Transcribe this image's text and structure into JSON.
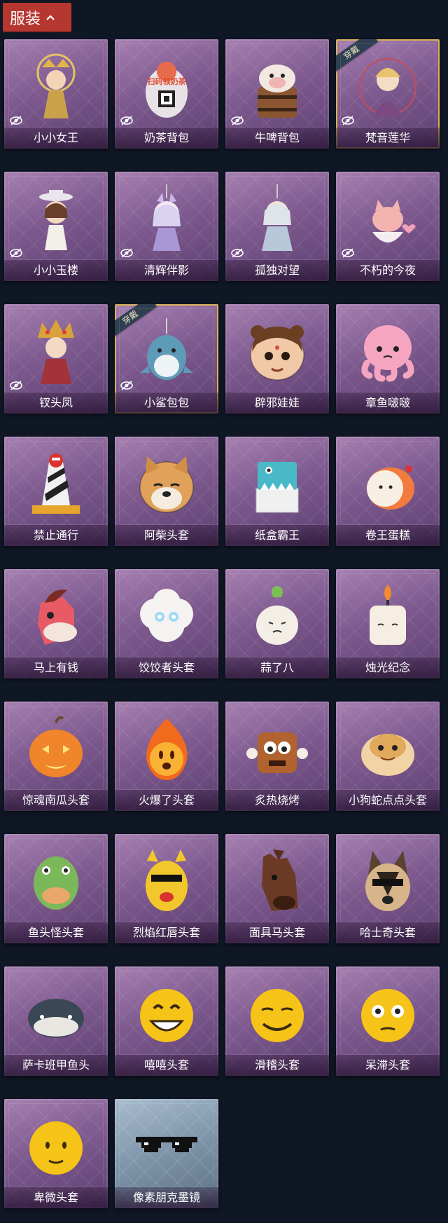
{
  "header": {
    "title": "服装"
  },
  "badge_text": "穿戴",
  "items": [
    {
      "name": "小小女王",
      "icon": "queen-figurine-icon",
      "hidden_eye": true,
      "equipped": false
    },
    {
      "name": "奶茶背包",
      "icon": "milk-tea-backpack-icon",
      "hidden_eye": true,
      "equipped": false,
      "art_text": "扫码领奶茶"
    },
    {
      "name": "牛啤背包",
      "icon": "cow-beer-backpack-icon",
      "hidden_eye": true,
      "equipped": false
    },
    {
      "name": "梵音莲华",
      "icon": "lotus-figurine-icon",
      "hidden_eye": true,
      "equipped": true
    },
    {
      "name": "小小玉楼",
      "icon": "jade-tower-figurine-icon",
      "hidden_eye": true,
      "equipped": false
    },
    {
      "name": "清辉伴影",
      "icon": "moonlight-figurine-icon",
      "hidden_eye": true,
      "equipped": false
    },
    {
      "name": "孤独对望",
      "icon": "lonely-gaze-figurine-icon",
      "hidden_eye": true,
      "equipped": false
    },
    {
      "name": "不朽的今夜",
      "icon": "fox-teacup-icon",
      "hidden_eye": true,
      "equipped": false
    },
    {
      "name": "钗头凤",
      "icon": "phoenix-crown-figurine-icon",
      "hidden_eye": true,
      "equipped": false
    },
    {
      "name": "小鲨包包",
      "icon": "shark-bag-icon",
      "hidden_eye": true,
      "equipped": true
    },
    {
      "name": "辟邪娃娃",
      "icon": "doll-head-icon",
      "hidden_eye": false,
      "equipped": false
    },
    {
      "name": "章鱼啵啵",
      "icon": "octopus-head-icon",
      "hidden_eye": false,
      "equipped": false
    },
    {
      "name": "禁止通行",
      "icon": "traffic-cone-icon",
      "hidden_eye": false,
      "equipped": false
    },
    {
      "name": "阿柴头套",
      "icon": "shiba-head-icon",
      "hidden_eye": false,
      "equipped": false
    },
    {
      "name": "纸盒霸王",
      "icon": "box-dino-icon",
      "hidden_eye": false,
      "equipped": false
    },
    {
      "name": "卷王蛋糕",
      "icon": "roll-cake-icon",
      "hidden_eye": false,
      "equipped": false
    },
    {
      "name": "马上有钱",
      "icon": "pink-horse-icon",
      "hidden_eye": false,
      "equipped": false
    },
    {
      "name": "饺饺者头套",
      "icon": "cloud-dumpling-icon",
      "hidden_eye": false,
      "equipped": false
    },
    {
      "name": "蒜了八",
      "icon": "garlic-icon",
      "hidden_eye": false,
      "equipped": false
    },
    {
      "name": "烛光纪念",
      "icon": "candle-icon",
      "hidden_eye": false,
      "equipped": false
    },
    {
      "name": "惊魂南瓜头套",
      "icon": "pumpkin-icon",
      "hidden_eye": false,
      "equipped": false
    },
    {
      "name": "火爆了头套",
      "icon": "fire-spirit-icon",
      "hidden_eye": false,
      "equipped": false
    },
    {
      "name": "炙热烧烤",
      "icon": "bbq-meat-icon",
      "hidden_eye": false,
      "equipped": false
    },
    {
      "name": "小狗蛇点点头套",
      "icon": "dog-snake-icon",
      "hidden_eye": false,
      "equipped": false
    },
    {
      "name": "鱼头怪头套",
      "icon": "fish-monster-icon",
      "hidden_eye": false,
      "equipped": false
    },
    {
      "name": "烈焰红唇头套",
      "icon": "yellow-lips-icon",
      "hidden_eye": false,
      "equipped": false
    },
    {
      "name": "面具马头套",
      "icon": "horse-mask-icon",
      "hidden_eye": false,
      "equipped": false
    },
    {
      "name": "哈士奇头套",
      "icon": "husky-icon",
      "hidden_eye": false,
      "equipped": false
    },
    {
      "name": "萨卡班甲鱼头",
      "icon": "whale-fish-icon",
      "hidden_eye": false,
      "equipped": false
    },
    {
      "name": "嘻嘻头套",
      "icon": "grin-emoji-icon",
      "hidden_eye": false,
      "equipped": false
    },
    {
      "name": "滑稽头套",
      "icon": "funny-emoji-icon",
      "hidden_eye": false,
      "equipped": false
    },
    {
      "name": "呆滞头套",
      "icon": "dazed-emoji-icon",
      "hidden_eye": false,
      "equipped": false
    },
    {
      "name": "卑微头套",
      "icon": "humble-emoji-icon",
      "hidden_eye": false,
      "equipped": false
    },
    {
      "name": "像素朋克墨镜",
      "icon": "pixel-sunglasses-icon",
      "hidden_eye": false,
      "equipped": false,
      "silver": true
    }
  ]
}
